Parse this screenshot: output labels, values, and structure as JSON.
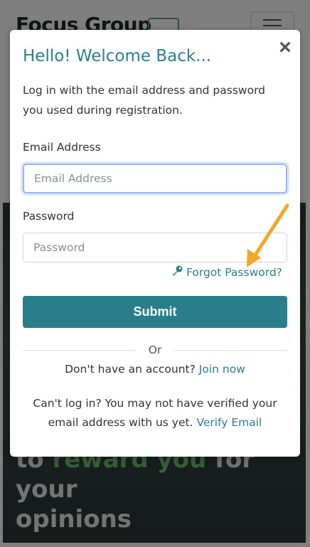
{
  "background": {
    "brand": "Focus Group",
    "hero_line1_a": "to",
    "hero_line1_accent": "reward you",
    "hero_line1_b": "for your",
    "hero_line2": "opinions"
  },
  "modal": {
    "title": "Hello! Welcome Back...",
    "description": "Log in with the email address and password you used during registration.",
    "email_label": "Email Address",
    "email_placeholder": "Email Address",
    "password_label": "Password",
    "password_placeholder": "Password",
    "forgot_label": "Forgot Password?",
    "submit_label": "Submit",
    "or_text": "Or",
    "no_account_text": "Don't have an account?",
    "join_label": "Join now",
    "verify_text": "Can't log in? You may not have verified your email address with us yet.",
    "verify_link": "Verify Email"
  },
  "icons": {
    "close": "close-icon",
    "key": "key-icon",
    "menu": "hamburger-icon"
  },
  "colors": {
    "accent": "#2a7e8a",
    "link": "#2c7f8c",
    "annotation_arrow": "#f5a623"
  }
}
